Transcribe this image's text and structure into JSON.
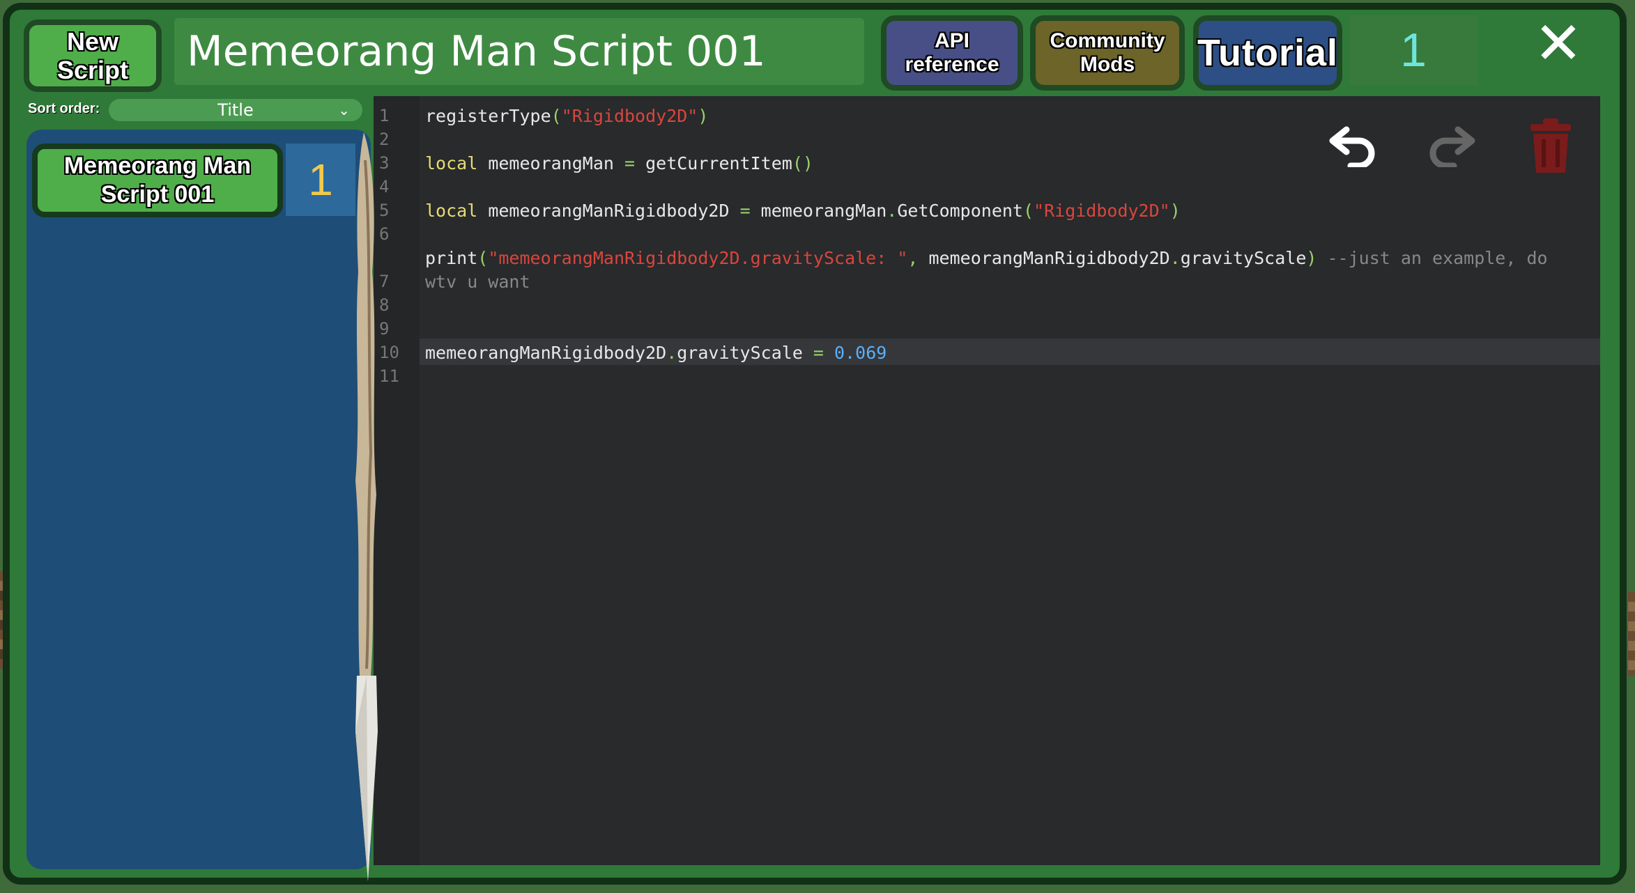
{
  "header": {
    "new_script_line1": "New",
    "new_script_line2": "Script",
    "script_title": "Memeorang Man Script 001",
    "api_line1": "API",
    "api_line2": "reference",
    "community_line1": "Community",
    "community_line2": "Mods",
    "tutorial_label": "Tutorial",
    "count": "1",
    "close_icon": "close-icon"
  },
  "sidebar": {
    "sort_label": "Sort order:",
    "sort_value": "Title",
    "items": [
      {
        "line1": "Memeorang Man",
        "line2": "Script 001",
        "count": "1"
      }
    ]
  },
  "editor": {
    "line_numbers": [
      "1",
      "2",
      "3",
      "4",
      "5",
      "6",
      "7",
      "8",
      "9",
      "10",
      "11"
    ],
    "code": {
      "l1_fn": "registerType",
      "l1_p1": "(",
      "l1_str": "\"Rigidbody2D\"",
      "l1_p2": ")",
      "l3_kw": "local",
      "l3_var": " memeorangMan ",
      "l3_eq": "=",
      "l3_call": " getCurrentItem",
      "l3_p": "()",
      "l5_kw": "local",
      "l5_var": " memeorangManRigidbody2D ",
      "l5_eq": "=",
      "l5_obj": " memeorangMan",
      "l5_dot": ".",
      "l5_m": "GetComponent",
      "l5_p1": "(",
      "l5_str": "\"Rigidbody2D\"",
      "l5_p2": ")",
      "l6_fn": "print",
      "l6_p1": "(",
      "l6_str": "\"memeorangManRigidbody2D.gravityScale: \"",
      "l6_c": ",",
      "l6_obj": " memeorangManRigidbody2D",
      "l6_dot": ".",
      "l6_prop": "gravityScale",
      "l6_p2": ")",
      "l6_cm": " --just an example, do",
      "l7_cm": "wtv u want",
      "l10_obj": "memeorangManRigidbody2D",
      "l10_dot": ".",
      "l10_prop": "gravityScale ",
      "l10_eq": "=",
      "l10_num": " 0.069"
    },
    "tools": {
      "undo": "undo-icon",
      "redo": "redo-icon",
      "delete": "trash-icon"
    }
  },
  "colors": {
    "window_green": "#2f7a38",
    "editor_bg": "#282a2c",
    "keyword": "#e6db74",
    "string": "#d9463d",
    "number": "#5ab0ff",
    "count_cyan": "#6fe4dd",
    "count_yellow": "#f2c94c"
  }
}
